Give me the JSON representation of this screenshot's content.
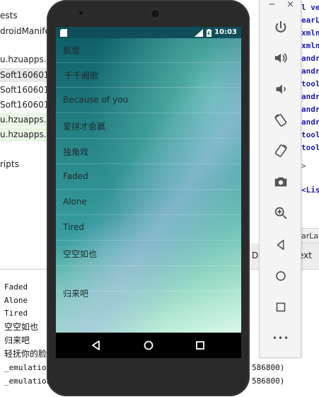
{
  "ide_tree": {
    "rows": [
      "ests",
      "droidManife",
      "u.hzuapps.a",
      "Soft160601",
      "Soft160601",
      "Soft160601",
      "u.hzuapps.a",
      "u.hzuapps.a",
      "ripts"
    ]
  },
  "ide_code": {
    "lines": [
      "l ve",
      "earL",
      "xmln",
      "xmln",
      "andr",
      "andr",
      "tool",
      "andr",
      "andr",
      "andr",
      "tool",
      "tool",
      ">",
      "<Lis"
    ]
  },
  "ide_tabs": {
    "tab": "arLa",
    "design_left": "D",
    "design_right": "ext"
  },
  "console": {
    "lines": [
      "Faded",
      "Alone",
      "Tired",
      "空空如也",
      "归来吧",
      "轻抚你的脸",
      "_emulation:",
      "_emulation:"
    ],
    "right": [
      "586800)",
      "586800)"
    ]
  },
  "emulator_toolbar": {
    "minimize_label": "−",
    "close_label": "×",
    "more_label": "•••"
  },
  "status_bar": {
    "time": "10:03"
  },
  "songs": [
    "飘雪",
    "千千阙歌",
    "Because of you",
    "爱拼才会赢",
    "独角戏",
    "Faded",
    "Alone",
    "Tired",
    "空空如也",
    "归来吧"
  ]
}
